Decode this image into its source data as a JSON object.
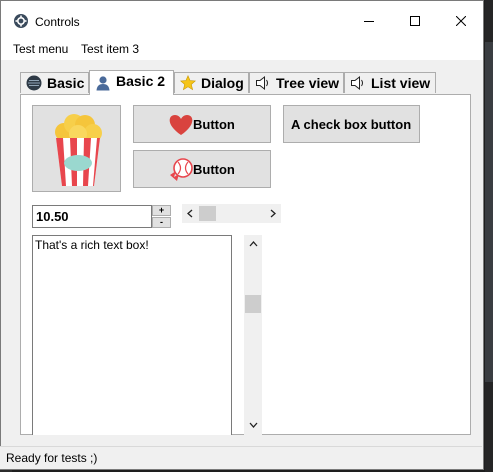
{
  "window": {
    "title": "Controls"
  },
  "menu": {
    "items": [
      "Test menu",
      "Test item 3"
    ]
  },
  "tabs": [
    {
      "label": "Basic",
      "icon": "ball-icon"
    },
    {
      "label": "Basic 2",
      "icon": "user-icon"
    },
    {
      "label": "Dialog",
      "icon": "star-icon"
    },
    {
      "label": "Tree view",
      "icon": "speaker-icon"
    },
    {
      "label": "List view",
      "icon": "speaker-icon"
    }
  ],
  "active_tab": "Basic 2",
  "buttons": {
    "heart_button": "Button",
    "ball_button": "Button",
    "checkbox_button": "A check box button"
  },
  "spin": {
    "value": "10.50",
    "up": "+",
    "down": "-"
  },
  "richtext": {
    "text": "That's a rich text box!"
  },
  "status": {
    "text": "Ready for tests ;)"
  },
  "colors": {
    "heart": "#d9433e",
    "popcorn_stripe": "#e8464d",
    "popcorn": "#f5c53b"
  }
}
